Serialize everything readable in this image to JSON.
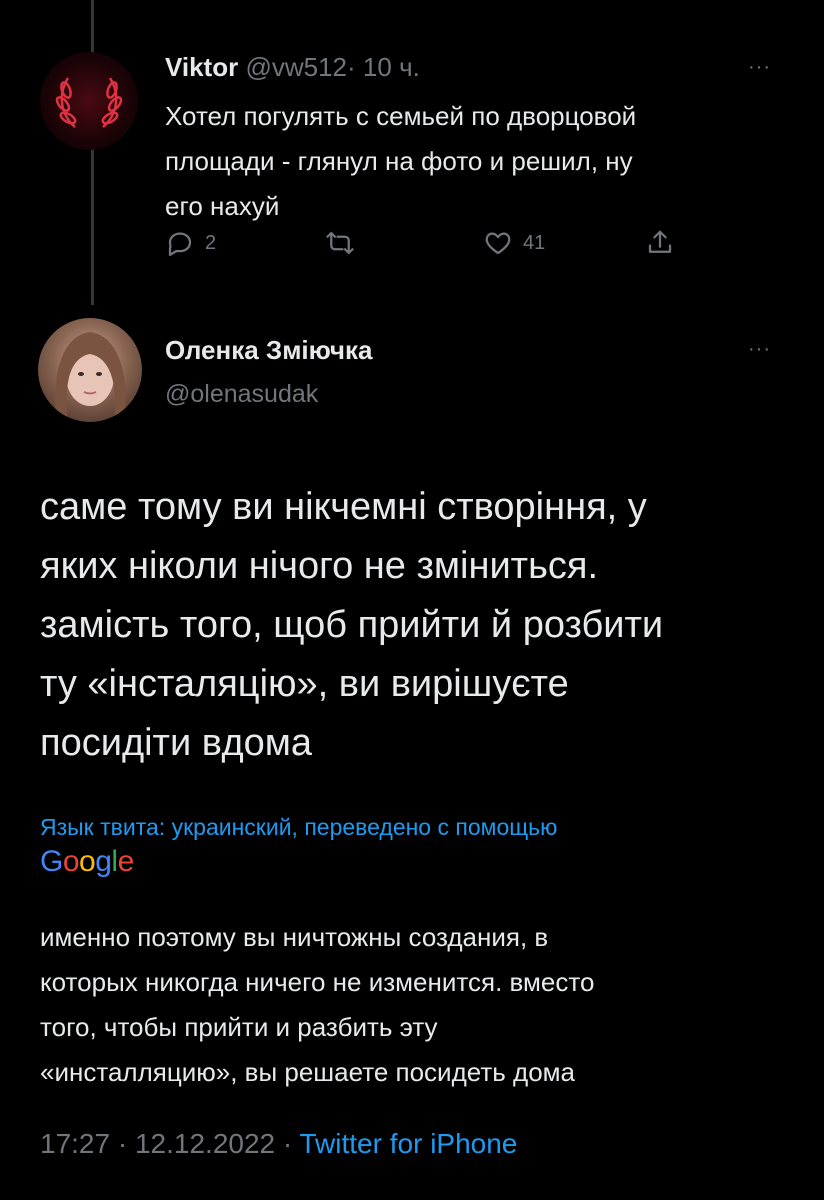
{
  "tweet1": {
    "author_name": "Viktor",
    "handle": "@vw512",
    "separator": "·",
    "time": "10 ч.",
    "more": "···",
    "text_lines": [
      "Хотел погулять с семьей по дворцовой",
      "площади - глянул на фото и решил, ну",
      "его нахуй"
    ],
    "actions": {
      "reply_count": "2",
      "like_count": "41"
    }
  },
  "tweet2": {
    "author_name": "Оленка Зміючка",
    "handle": "@olenasudak",
    "more": "···",
    "text_lines": [
      "саме тому ви нікчемні створіння, у",
      "яких ніколи нічого не зміниться.",
      "замість того, щоб прийти й розбити",
      "ту «інсталяцію», ви вирішуєте",
      "посидіти вдома"
    ],
    "translation_note": "Язык твита: украинский, переведено с помощью",
    "google_letters": [
      "G",
      "o",
      "o",
      "g",
      "l",
      "e"
    ],
    "translation_lines": [
      "именно поэтому вы ничтожны создания, в",
      "которых никогда ничего не изменится. вместо",
      "того, чтобы прийти и разбить эту",
      "«инсталляцию», вы решаете посидеть дома"
    ],
    "time": "17:27",
    "date": "12.12.2022",
    "separator": "·",
    "source": "Twitter for iPhone"
  },
  "colors": {
    "background": "#000000",
    "text": "#e7e9ea",
    "muted": "#71767b",
    "link": "#1d9bf0",
    "google_blue": "#4285F4",
    "google_red": "#EA4335",
    "google_yellow": "#FBBC05",
    "google_green": "#34A853"
  },
  "icons": [
    "reply-icon",
    "retweet-icon",
    "like-icon",
    "share-icon",
    "more-icon"
  ]
}
